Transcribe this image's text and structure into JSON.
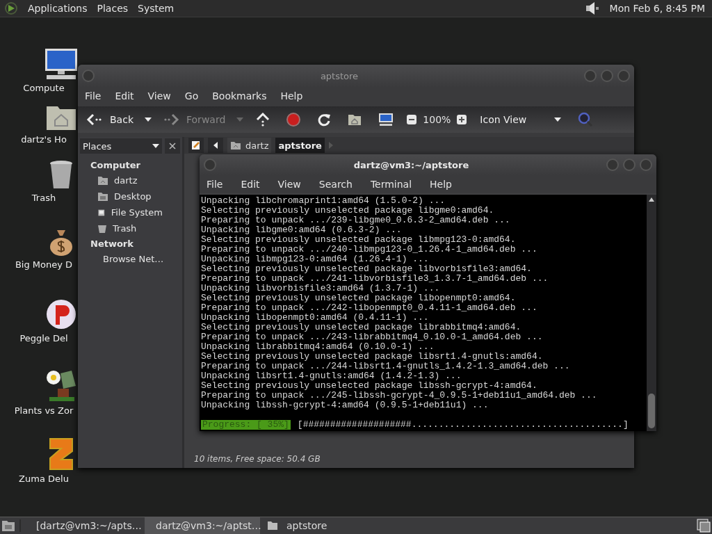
{
  "top_panel": {
    "menus": [
      "Applications",
      "Places",
      "System"
    ],
    "clock": "Mon Feb  6,  8:45 PM"
  },
  "desktop_icons": [
    {
      "label": "Compute",
      "kind": "computer"
    },
    {
      "label": "dartz's Ho",
      "kind": "home"
    },
    {
      "label": "Trash",
      "kind": "trash"
    },
    {
      "label": "Big Money D",
      "kind": "money"
    },
    {
      "label": "Peggle Del",
      "kind": "peggle"
    },
    {
      "label": "Plants vs Zor",
      "kind": "plant"
    },
    {
      "label": "Zuma Delu",
      "kind": "zuma"
    }
  ],
  "file_manager": {
    "title": "aptstore",
    "menu": [
      "File",
      "Edit",
      "View",
      "Go",
      "Bookmarks",
      "Help"
    ],
    "toolbar": {
      "back": "Back",
      "forward": "Forward",
      "zoom": "100%",
      "view": "Icon View"
    },
    "sidebar": {
      "header": "Places",
      "sections": [
        {
          "title": "Computer",
          "items": [
            {
              "label": "dartz",
              "kind": "home"
            },
            {
              "label": "Desktop",
              "kind": "desktop"
            },
            {
              "label": "File System",
              "kind": "drive"
            },
            {
              "label": "Trash",
              "kind": "trash"
            }
          ]
        },
        {
          "title": "Network",
          "items": [
            {
              "label": "Browse Net…",
              "kind": "network"
            }
          ]
        }
      ]
    },
    "path": [
      {
        "label": "dartz",
        "selected": false
      },
      {
        "label": "aptstore",
        "selected": true
      }
    ],
    "status": "10 items, Free space: 50.4 GB"
  },
  "terminal": {
    "title": "dartz@vm3:~/aptstore",
    "menu": [
      "File",
      "Edit",
      "View",
      "Search",
      "Terminal",
      "Help"
    ],
    "lines": [
      "Unpacking libchromaprint1:amd64 (1.5.0-2) ...",
      "Selecting previously unselected package libgme0:amd64.",
      "Preparing to unpack .../239-libgme0_0.6.3-2_amd64.deb ...",
      "Unpacking libgme0:amd64 (0.6.3-2) ...",
      "Selecting previously unselected package libmpg123-0:amd64.",
      "Preparing to unpack .../240-libmpg123-0_1.26.4-1_amd64.deb ...",
      "Unpacking libmpg123-0:amd64 (1.26.4-1) ...",
      "Selecting previously unselected package libvorbisfile3:amd64.",
      "Preparing to unpack .../241-libvorbisfile3_1.3.7-1_amd64.deb ...",
      "Unpacking libvorbisfile3:amd64 (1.3.7-1) ...",
      "Selecting previously unselected package libopenmpt0:amd64.",
      "Preparing to unpack .../242-libopenmpt0_0.4.11-1_amd64.deb ...",
      "Unpacking libopenmpt0:amd64 (0.4.11-1) ...",
      "Selecting previously unselected package librabbitmq4:amd64.",
      "Preparing to unpack .../243-librabbitmq4_0.10.0-1_amd64.deb ...",
      "Unpacking librabbitmq4:amd64 (0.10.0-1) ...",
      "Selecting previously unselected package libsrt1.4-gnutls:amd64.",
      "Preparing to unpack .../244-libsrt1.4-gnutls_1.4.2-1.3_amd64.deb ...",
      "Unpacking libsrt1.4-gnutls:amd64 (1.4.2-1.3) ...",
      "Selecting previously unselected package libssh-gcrypt-4:amd64.",
      "Preparing to unpack .../245-libssh-gcrypt-4_0.9.5-1+deb11u1_amd64.deb ...",
      "Unpacking libssh-gcrypt-4:amd64 (0.9.5-1+deb11u1) ..."
    ],
    "progress": {
      "label": "Progress: [ 35%]",
      "bar": "[####################.......................................]"
    }
  },
  "taskbar": {
    "items": [
      {
        "label": "[dartz@vm3:~/apts…",
        "kind": "terminal",
        "selected": false
      },
      {
        "label": "dartz@vm3:~/aptst…",
        "kind": "terminal",
        "selected": true
      },
      {
        "label": "aptstore",
        "kind": "folder",
        "selected": false
      }
    ]
  }
}
